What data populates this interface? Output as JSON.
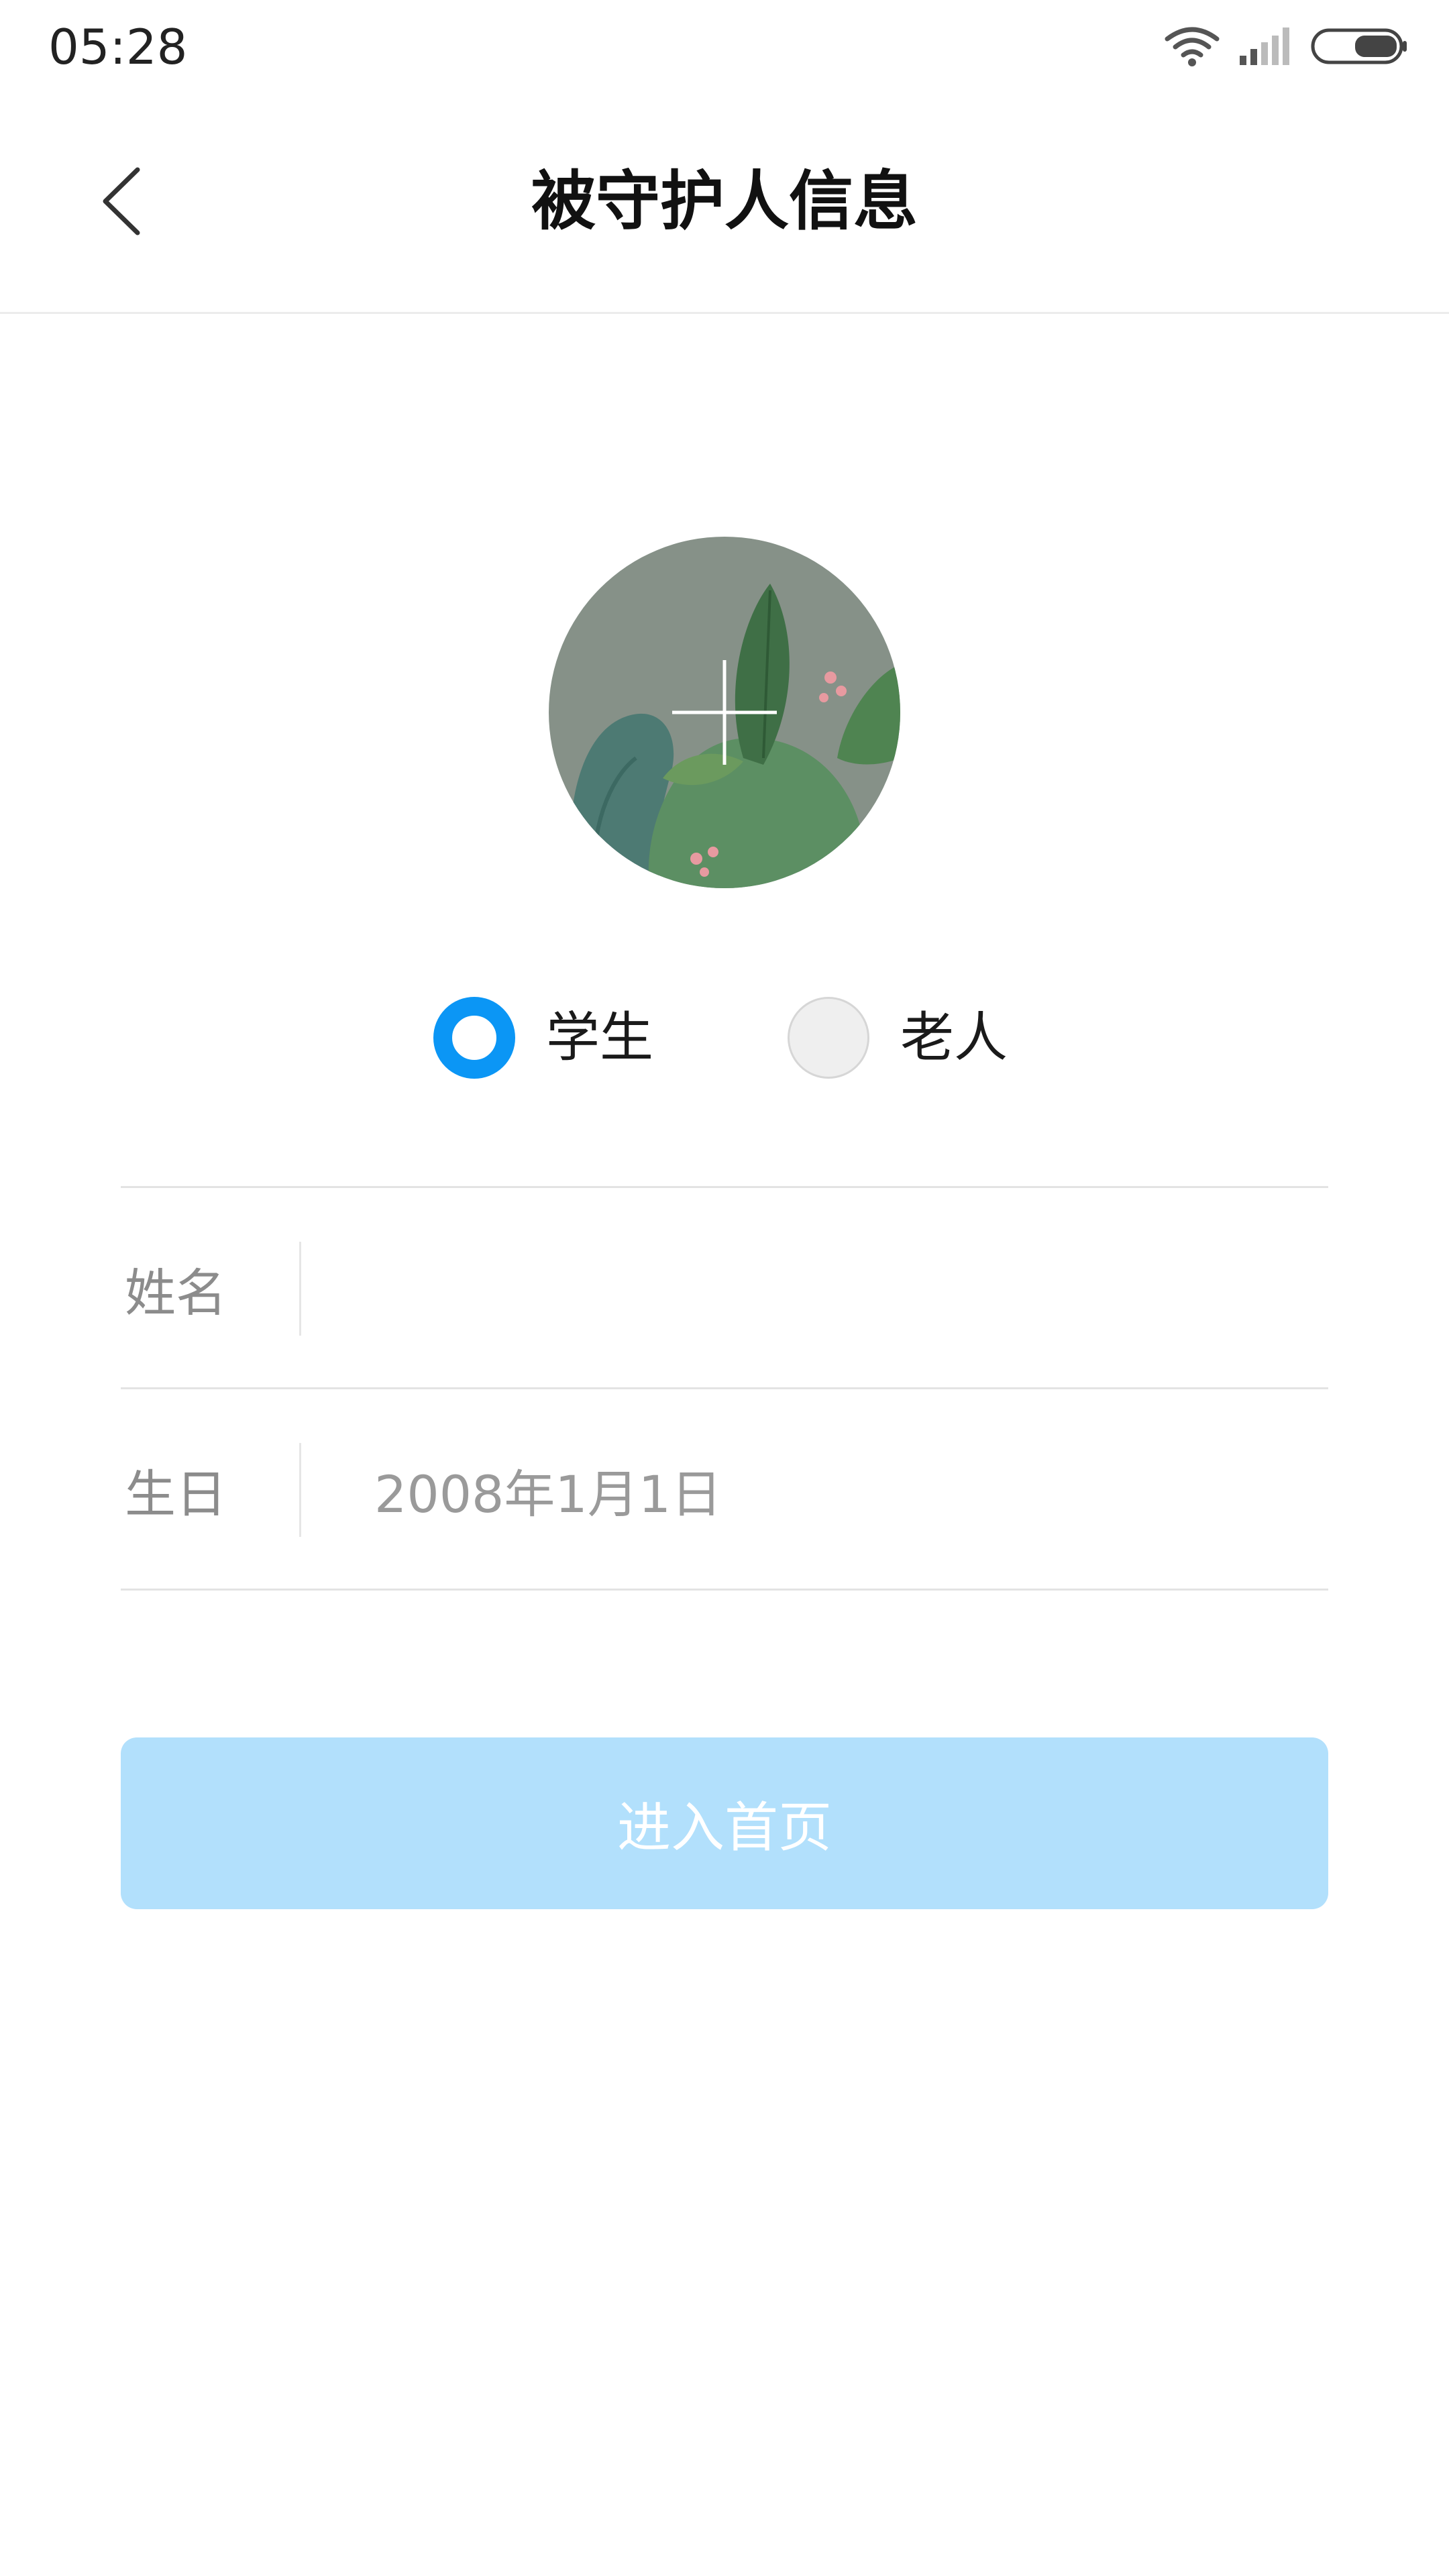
{
  "status_bar": {
    "time": "05:28",
    "icons": [
      "wifi-icon",
      "signal-icon",
      "battery-icon"
    ]
  },
  "header": {
    "title": "被守护人信息",
    "back_icon": "chevron-left-icon"
  },
  "avatar": {
    "add_icon": "plus-icon"
  },
  "role": {
    "options": [
      {
        "label": "学生",
        "selected": true
      },
      {
        "label": "老人",
        "selected": false
      }
    ]
  },
  "form": {
    "name": {
      "label": "姓名",
      "value": ""
    },
    "birthday": {
      "label": "生日",
      "value": "2008年1月1日"
    }
  },
  "submit": {
    "label": "进入首页"
  },
  "colors": {
    "accent": "#0b96f5",
    "button_disabled": "#b2e0fc",
    "label_gray": "#8c8c8c"
  }
}
